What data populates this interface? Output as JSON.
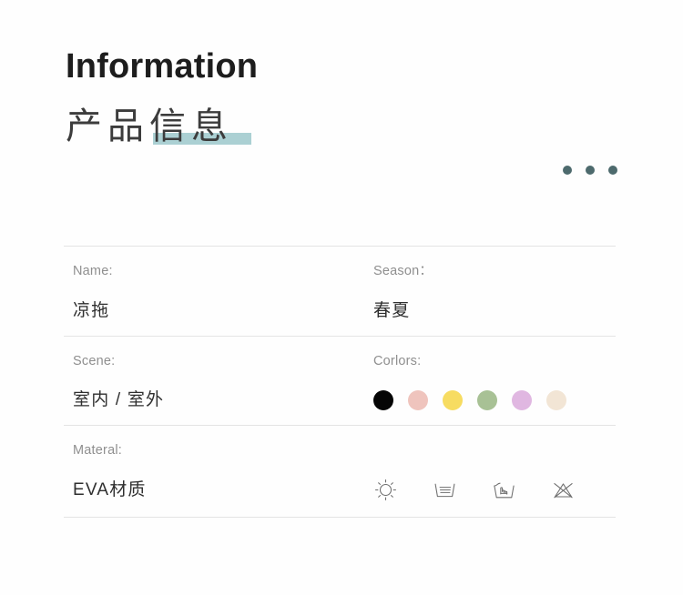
{
  "header": {
    "title_en": "Information",
    "title_cn": "产品信息",
    "underline_color": "#a7cdd1"
  },
  "dots": {
    "count": 3,
    "color": "#4d6a6d",
    "name": "more-options"
  },
  "info": {
    "rows": [
      {
        "left": {
          "label": "Name:",
          "value": "凉拖"
        },
        "right": {
          "label": "Season：",
          "value": "春夏"
        }
      },
      {
        "left": {
          "label": "Scene:",
          "value": "室内 / 室外"
        },
        "right": {
          "label": "Corlors:",
          "value": ""
        }
      },
      {
        "left": {
          "label": "Materal:",
          "value": "EVA材质"
        },
        "right": {
          "label": "",
          "value": ""
        }
      }
    ],
    "colors": [
      {
        "name": "black",
        "hex": "#050505"
      },
      {
        "name": "pink",
        "hex": "#efc4bd"
      },
      {
        "name": "yellow",
        "hex": "#f7dc61"
      },
      {
        "name": "green",
        "hex": "#a8c195"
      },
      {
        "name": "lavender",
        "hex": "#e0b7e1"
      },
      {
        "name": "cream",
        "hex": "#f2e5d5"
      }
    ],
    "care_icons": [
      {
        "name": "sun-dry-icon",
        "label": "日晒"
      },
      {
        "name": "dry-flat-icon",
        "label": "平铺晾干"
      },
      {
        "name": "hand-wash-icon",
        "label": "手洗"
      },
      {
        "name": "do-not-bleach-icon",
        "label": "不可漂白"
      }
    ],
    "divider_color": "#e4e4e4"
  }
}
